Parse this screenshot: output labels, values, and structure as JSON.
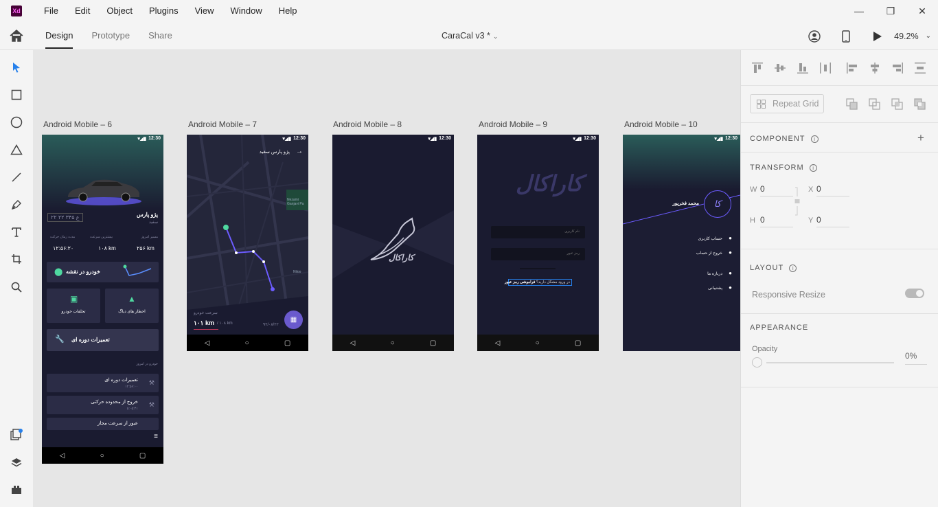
{
  "app": {
    "logo": "Xd"
  },
  "menu": [
    "File",
    "Edit",
    "Object",
    "Plugins",
    "View",
    "Window",
    "Help"
  ],
  "window_controls": {
    "minimize": "—",
    "maximize": "❐",
    "close": "✕"
  },
  "header": {
    "tabs": [
      {
        "label": "Design",
        "active": true
      },
      {
        "label": "Prototype",
        "active": false
      },
      {
        "label": "Share",
        "active": false
      }
    ],
    "doc_title": "CaraCal v3 *",
    "zoom": "49.2%"
  },
  "tools": [
    "select-tool",
    "rectangle-tool",
    "ellipse-tool",
    "polygon-tool",
    "line-tool",
    "pen-tool",
    "text-tool",
    "artboard-tool",
    "zoom-tool",
    "assets-icon",
    "layers-icon",
    "plugins-icon"
  ],
  "canvas": {
    "artboards": [
      {
        "label": "Android Mobile – 6"
      },
      {
        "label": "Android Mobile – 7"
      },
      {
        "label": "Android Mobile – 8"
      },
      {
        "label": "Android Mobile – 9"
      },
      {
        "label": "Android Mobile – 10"
      }
    ],
    "status_time": "12:30",
    "nav": {
      "back": "◁",
      "home": "○",
      "recent": "▢"
    },
    "ab6": {
      "car_name": "پژو پارس",
      "car_color": "سفید",
      "plate": "۲۲ ع ۳۴۵ ۲۲",
      "stat_labels": [
        "مدت زمان حرکت",
        "بیشترین سرعت",
        "مسیر امروز"
      ],
      "stat_values": [
        "۱۲:۵۶:۲۰",
        "۱۰۸ km",
        "۲۵۶ km"
      ],
      "map_card": "خودرو در نقشه",
      "tile_left": "تخلفات خودرو",
      "tile_right": "اخطار های دیاگ",
      "service_card": "تعمیرات دوره ای",
      "list_header": "خودرو در امروز",
      "list_items": [
        {
          "title": "تعمیرات دوره ای",
          "time": "۱۲:۵۶:۰۰"
        },
        {
          "title": "خروج از محدوده حرکتی",
          "time": "۵:۰۵:۴۱"
        },
        {
          "title": "عبور از سرعت مجاز",
          "time": ""
        }
      ]
    },
    "ab7": {
      "car_name": "پژو پارس سفید",
      "speed_label": "سرعت خودرو",
      "speed_value": "۱۰۱ km",
      "speed_max": "/ ۱۰۸ km",
      "date": "۹۲/۰۸/۲۲",
      "map_labels": [
        "Nezami Ganjavi Pa",
        "Niloo"
      ]
    },
    "ab8": {
      "logo_text": "کاراکال"
    },
    "ab9": {
      "logo_text": "کاراکال",
      "username_placeholder": "نام کاربری",
      "password_placeholder": "رمز عبور",
      "help_text": "در ورود مشکل دارید؟",
      "forgot_link": "فراموشی رمز عبور"
    },
    "ab10": {
      "user_name": "محمد فخرپور",
      "avatar_text": "کا",
      "menu_items": [
        "حساب کاربری",
        "خروج از حساب",
        "درباره ما",
        "پشتیبانی"
      ]
    }
  },
  "panel": {
    "repeat_grid": "Repeat Grid",
    "component_title": "COMPONENT",
    "component_add": "+",
    "transform_title": "TRANSFORM",
    "w_label": "W",
    "w_value": "0",
    "x_label": "X",
    "x_value": "0",
    "h_label": "H",
    "h_value": "0",
    "y_label": "Y",
    "y_value": "0",
    "layout_title": "LAYOUT",
    "responsive_resize": "Responsive Resize",
    "responsive_resize_on": true,
    "appearance_title": "APPEARANCE",
    "opacity_label": "Opacity",
    "opacity_value": "0%"
  },
  "colors": {
    "accent": "#2680eb",
    "artboard_bg": "#1a1b30",
    "brand_purple": "#5b4fd8"
  }
}
